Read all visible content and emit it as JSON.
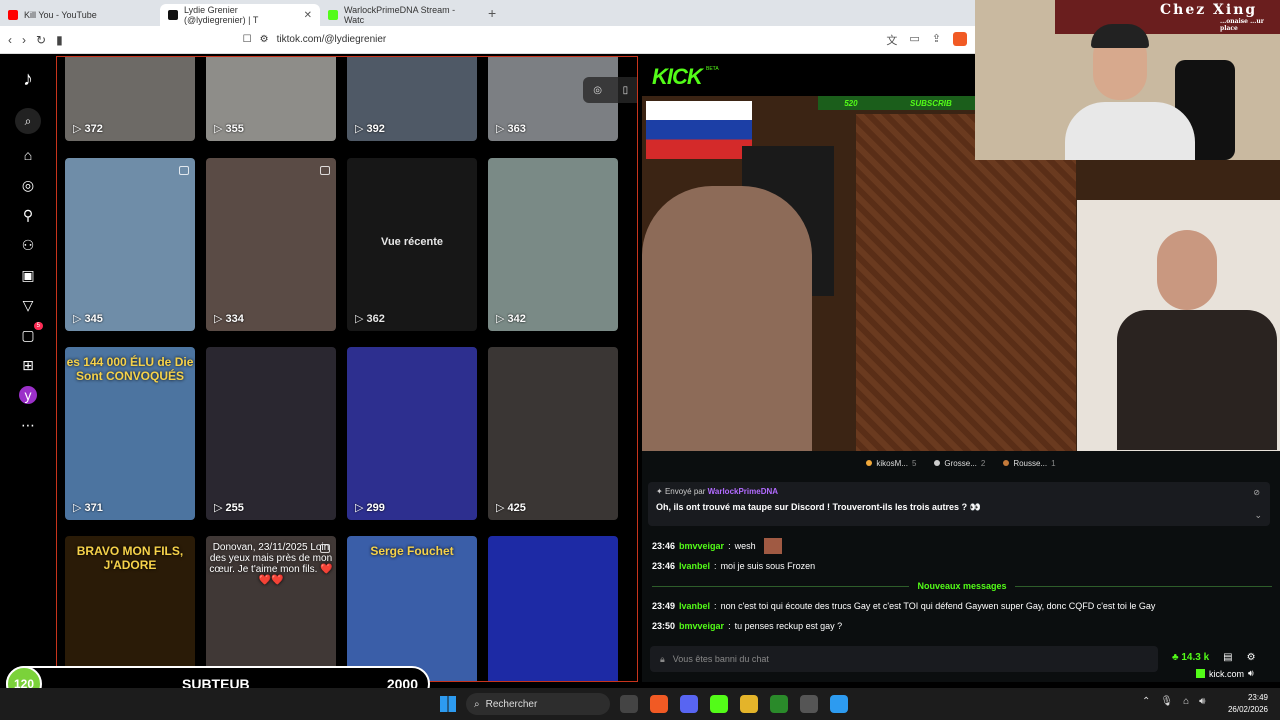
{
  "browser": {
    "tabs": [
      {
        "title": "Kill You - YouTube",
        "color": "#ff0000"
      },
      {
        "title": "Lydie Grenier (@lydiegrenier) | T",
        "color": "#111111"
      },
      {
        "title": "WarlockPrimeDNA Stream - Watc",
        "color": "#53fc18"
      }
    ],
    "new_tab": "+",
    "url": "tiktok.com/@lydiegrenier"
  },
  "tiktok": {
    "nav_icons": [
      "tiktok-logo",
      "search",
      "home",
      "explore",
      "following",
      "friends",
      "live",
      "activity",
      "messages",
      "upload",
      "profile",
      "more"
    ],
    "messages_badge": "5",
    "profile_initial": "y",
    "viewed_label": "Vue récente",
    "tiles": [
      {
        "views": "372",
        "bg": "#6d6a66"
      },
      {
        "views": "355",
        "bg": "#8e8d89"
      },
      {
        "views": "392",
        "bg": "#4f5966"
      },
      {
        "views": "363",
        "bg": "#7c7f83"
      },
      {
        "views": "345",
        "bg": "#6f8da8"
      },
      {
        "views": "334",
        "bg": "#5a4b45"
      },
      {
        "views": "362",
        "bg": "#1a1a1a"
      },
      {
        "views": "342",
        "bg": "#7a8a86"
      },
      {
        "views": "371",
        "bg": "#4c74a0",
        "caption": "es 144 000 ÉLU de Die Sont CONVOQUÉS"
      },
      {
        "views": "255",
        "bg": "#2a2730"
      },
      {
        "views": "299",
        "bg": "#2d2f8f"
      },
      {
        "views": "425",
        "bg": "#3a3634"
      },
      {
        "views": "",
        "bg": "#2a1b07",
        "caption": "BRAVO MON FILS, J'ADORE"
      },
      {
        "views": "",
        "bg": "#403836",
        "caption": "Donovan, 23/11/2025 Loin des yeux mais près de mon cœur. Je t'aime mon fils. ❤️❤️❤️"
      },
      {
        "views": "",
        "bg": "#3a5ea8",
        "caption": "Serge Fouchet"
      },
      {
        "views": "",
        "bg": "#1d2aa5"
      }
    ],
    "mini_avatar": "y"
  },
  "kick": {
    "logo": "KICK",
    "beta": "BETA",
    "sub_count": "520",
    "sub_label": "SUBSCRIB",
    "leaders": [
      {
        "name": "kikosM...",
        "count": "5",
        "color": "#f2a93b"
      },
      {
        "name": "Grosse...",
        "count": "2",
        "color": "#cccccc"
      },
      {
        "name": "Rousse...",
        "count": "1",
        "color": "#c47a3a"
      }
    ],
    "pinned": {
      "sent_by": "Envoyé par",
      "author": "WarlockPrimeDNA",
      "message": "Oh, ils ont trouvé ma taupe sur Discord ! Trouveront-ils les trois autres ? 👀"
    },
    "chat": [
      {
        "time": "23:46",
        "user": "bmvveigar",
        "text": "wesh",
        "emote": true
      },
      {
        "time": "23:46",
        "user": "Ivanbel",
        "text": "moi je suis sous Frozen"
      },
      {
        "divider": "Nouveaux messages"
      },
      {
        "time": "23:49",
        "user": "Ivanbel",
        "text": "non c'est toi qui écoute des trucs Gay et c'est TOI qui défend Gaywen super Gay, donc CQFD c'est toi le Gay"
      },
      {
        "time": "23:50",
        "user": "bmvveigar",
        "text": "tu penses reckup est gay ?"
      }
    ],
    "chat_placeholder": "Vous êtes banni du chat",
    "viewers": "14.3 k",
    "domain": "kick.com"
  },
  "webcam": {
    "sign": "Chez Xing",
    "sign_sub": "...onaise ...ur place"
  },
  "sub_goal": {
    "current": "120",
    "label": "SUBTEUB",
    "target": "2000"
  },
  "taskbar": {
    "search": "Rechercher",
    "time": "23:49",
    "date": "26/02/2026"
  }
}
